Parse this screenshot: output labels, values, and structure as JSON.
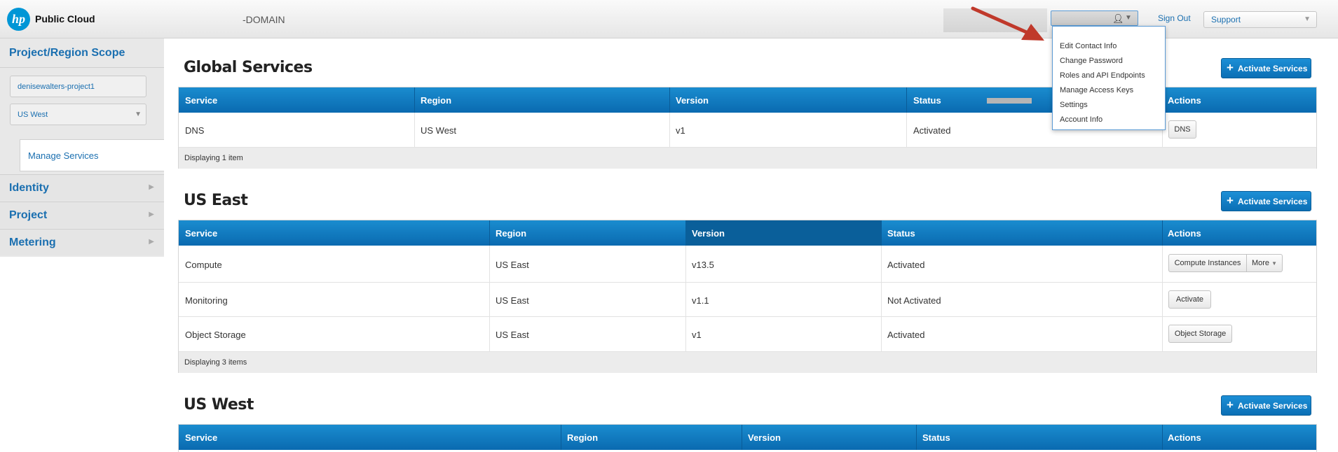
{
  "header": {
    "logo_mark": "hp",
    "logo_text": "Public Cloud",
    "domain": "-DOMAIN",
    "user_icon": "user-icon",
    "sign_out": "Sign Out",
    "support": "Support"
  },
  "user_menu": {
    "items": [
      "Edit Contact Info",
      "Change Password",
      "Roles and API Endpoints",
      "Manage Access Keys",
      "Settings",
      "Account Info"
    ]
  },
  "sidebar": {
    "title": "Project/Region Scope",
    "project": "denisewalters-project1",
    "region": "US West",
    "manage_services": "Manage Services",
    "sections": [
      "Identity",
      "Project",
      "Metering"
    ]
  },
  "columns": [
    "Service",
    "Region",
    "Version",
    "Status",
    "Actions"
  ],
  "activate_label": "Activate Services",
  "sections": {
    "global": {
      "title": "Global Services",
      "rows": [
        {
          "service": "DNS",
          "region": "US West",
          "version": "v1",
          "status": "Activated",
          "action": "DNS"
        }
      ],
      "footer": "Displaying 1 item"
    },
    "us_east": {
      "title": "US East",
      "rows": [
        {
          "service": "Compute",
          "region": "US East",
          "version": "v13.5",
          "status": "Activated",
          "action": "Compute Instances",
          "more": "More"
        },
        {
          "service": "Monitoring",
          "region": "US East",
          "version": "v1.1",
          "status": "Not Activated",
          "action": "Activate"
        },
        {
          "service": "Object Storage",
          "region": "US East",
          "version": "v1",
          "status": "Activated",
          "action": "Object Storage"
        }
      ],
      "footer": "Displaying 3 items"
    },
    "us_west": {
      "title": "US West"
    }
  },
  "colors": {
    "accent": "#1a6fb0",
    "table_header": "#0a6ab0",
    "arrow": "#c0392b"
  }
}
